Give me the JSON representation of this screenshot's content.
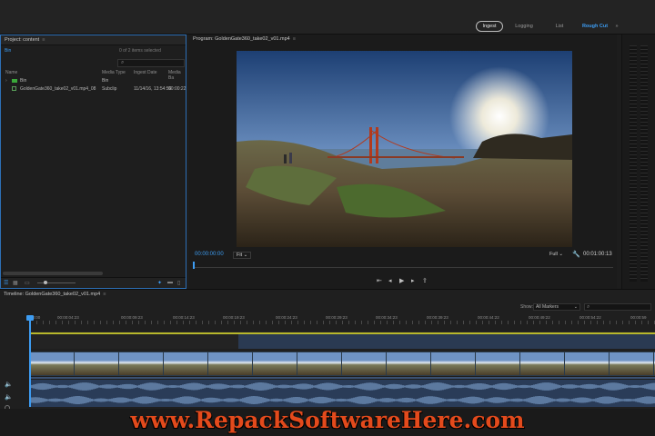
{
  "workspaces": [
    {
      "label": "Ingest",
      "active": true
    },
    {
      "label": "Logging",
      "active": false
    },
    {
      "label": "List",
      "active": false
    },
    {
      "label": "Rough Cut",
      "active": false,
      "highlight": true
    }
  ],
  "project": {
    "title": "Project: content",
    "path": "Bin",
    "items_selected": "0 of 2 items selected",
    "columns": [
      "Name",
      "Media Type",
      "Ingest Date",
      "Media Ba"
    ],
    "rows": [
      {
        "name": "Bin",
        "media_type": "Bin",
        "ingest_date": "",
        "media_base": ""
      },
      {
        "name": "GoldenGate360_take02_v01.mp4_08",
        "media_type": "Subclip",
        "ingest_date": "11/14/16, 13:54:56",
        "media_base": "00:00:22"
      }
    ]
  },
  "program": {
    "title": "Program: GoldenGate360_take02_v01.mp4",
    "timecode_in": "00:00:00:00",
    "fit_label": "Fit",
    "quality_label": "Full",
    "timecode_out": "00:01:00:13"
  },
  "timeline": {
    "title": "Timeline: GoldenGate360_take02_v01.mp4",
    "show_label": "Show:",
    "markers_label": "All Markers",
    "ruler": [
      "00:00",
      "00:00:04:23",
      "00:00:09:23",
      "00:00:14:23",
      "00:00:19:23",
      "00:00:24:23",
      "00:00:29:23",
      "00:00:34:23",
      "00:00:39:23",
      "00:00:44:22",
      "00:00:49:22",
      "00:00:54:22",
      "00:00:59"
    ]
  },
  "watermark": "www.RepackSoftwareHere.com",
  "colors": {
    "accent": "#3d9cf2",
    "selection_border": "#2d6fb5",
    "bin_green": "#3aa93a",
    "watermark": "#e34a1c",
    "marker_line": "#b8b82c"
  },
  "icons": [
    "list-view-icon",
    "icon-view-icon",
    "zoom-slider-icon",
    "new-bin-icon",
    "new-item-icon",
    "trash-icon",
    "search-icon",
    "wrench-icon",
    "mark-in-icon",
    "step-back-icon",
    "play-icon",
    "step-forward-icon",
    "export-frame-icon",
    "speaker-icon"
  ]
}
